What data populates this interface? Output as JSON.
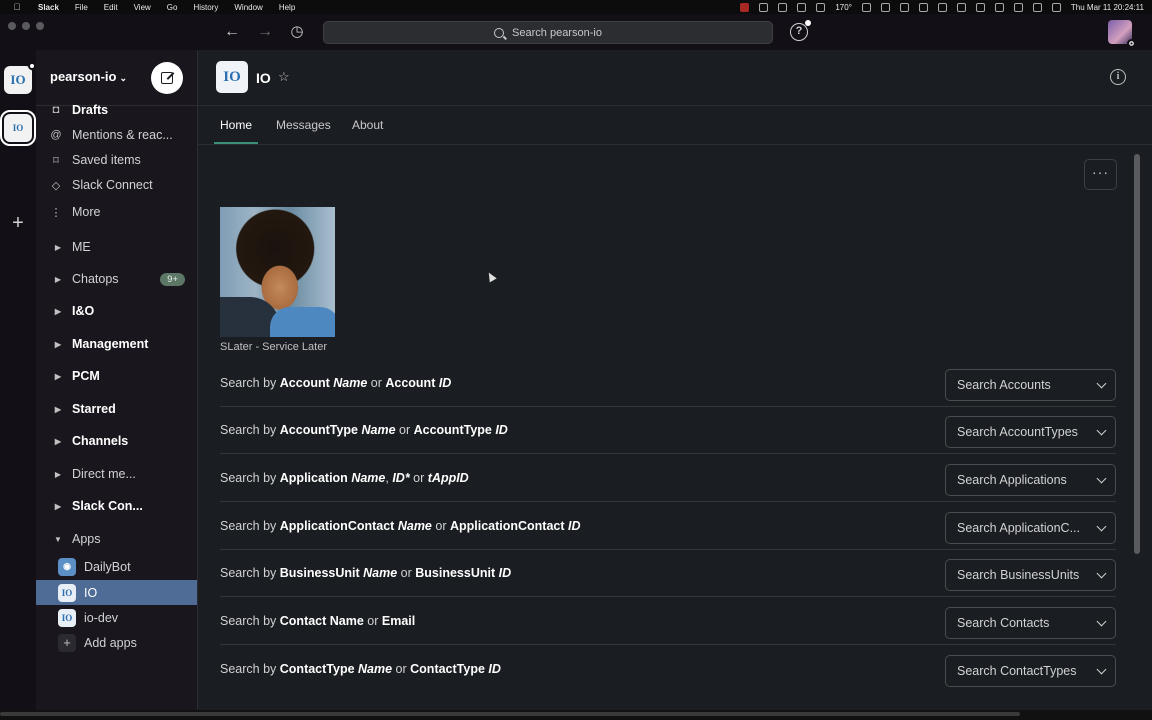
{
  "menubar": {
    "app": "Slack",
    "items": [
      "File",
      "Edit",
      "View",
      "Go",
      "History",
      "Window",
      "Help"
    ],
    "temp": "170°",
    "datetime": "Thu Mar 11  20:24:11"
  },
  "titlebar": {
    "search_placeholder": "Search pearson-io",
    "help_label": "?"
  },
  "workspace": {
    "name": "pearson-io",
    "icon_text": "IO"
  },
  "sidebar": {
    "nav": [
      {
        "label": "Drafts",
        "icon": "drafts-icon",
        "glyph": "◘"
      },
      {
        "label": "Mentions & reac...",
        "icon": "mention-icon",
        "glyph": "@"
      },
      {
        "label": "Saved items",
        "icon": "bookmark-icon",
        "glyph": "⌑"
      },
      {
        "label": "Slack Connect",
        "icon": "connect-icon",
        "glyph": "◇"
      },
      {
        "label": "More",
        "icon": "more-vertical-icon",
        "glyph": "⋮"
      }
    ],
    "sections": [
      {
        "label": "ME",
        "bold": false
      },
      {
        "label": "Chatops",
        "bold": false,
        "count": "9+"
      },
      {
        "label": "I&O",
        "bold": true
      },
      {
        "label": "Management",
        "bold": true
      },
      {
        "label": "PCM",
        "bold": true
      },
      {
        "label": "Starred",
        "bold": true
      },
      {
        "label": "Channels",
        "bold": true
      },
      {
        "label": "Direct me...",
        "bold": false
      },
      {
        "label": "Slack Con...",
        "bold": true
      },
      {
        "label": "Apps",
        "bold": false
      }
    ],
    "apps": [
      {
        "label": "DailyBot"
      },
      {
        "label": "IO"
      },
      {
        "label": "io-dev"
      },
      {
        "label": "Add apps"
      }
    ]
  },
  "channel": {
    "name": "IO",
    "icon_text": "IO",
    "tabs": [
      "Home",
      "Messages",
      "About"
    ],
    "more_label": "···",
    "image_caption": "SLater - Service Later"
  },
  "search_rows": [
    {
      "prefix": "Search by ",
      "parts": [
        [
          "b",
          "Account"
        ],
        [
          "t",
          " "
        ],
        [
          "i",
          "Name"
        ],
        [
          "t",
          " or "
        ],
        [
          "b",
          "Account"
        ],
        [
          "t",
          ""
        ],
        [
          "i",
          " ID"
        ]
      ],
      "button": "Search Accounts"
    },
    {
      "prefix": "Search by ",
      "parts": [
        [
          "b",
          "AccountType"
        ],
        [
          "t",
          " "
        ],
        [
          "i",
          "Name"
        ],
        [
          "t",
          " or "
        ],
        [
          "b",
          "AccountType"
        ],
        [
          "i",
          " ID"
        ]
      ],
      "button": "Search AccountTypes"
    },
    {
      "prefix": "Search by ",
      "parts": [
        [
          "b",
          "Application"
        ],
        [
          "t",
          " "
        ],
        [
          "i",
          "Name"
        ],
        [
          "t",
          ", "
        ],
        [
          "i",
          "ID*"
        ],
        [
          "t",
          " or "
        ],
        [
          "i",
          "tAppID"
        ]
      ],
      "button": "Search Applications"
    },
    {
      "prefix": "Search by ",
      "parts": [
        [
          "b",
          "ApplicationContact"
        ],
        [
          "t",
          " "
        ],
        [
          "i",
          "Name"
        ],
        [
          "t",
          " or "
        ],
        [
          "b",
          "ApplicationContact"
        ],
        [
          "i",
          " ID"
        ]
      ],
      "button": "Search ApplicationC..."
    },
    {
      "prefix": "Search by ",
      "parts": [
        [
          "b",
          "BusinessUnit"
        ],
        [
          "t",
          " "
        ],
        [
          "i",
          "Name"
        ],
        [
          "t",
          " or "
        ],
        [
          "b",
          "BusinessUnit"
        ],
        [
          "i",
          " ID"
        ]
      ],
      "button": "Search BusinessUnits"
    },
    {
      "prefix": "Search by ",
      "parts": [
        [
          "b",
          "Contact Name"
        ],
        [
          "t",
          " or "
        ],
        [
          "b",
          "Email"
        ]
      ],
      "button": "Search Contacts"
    },
    {
      "prefix": "Search by ",
      "parts": [
        [
          "b",
          "ContactType"
        ],
        [
          "t",
          " "
        ],
        [
          "i",
          "Name"
        ],
        [
          "t",
          " or "
        ],
        [
          "b",
          "ContactType"
        ],
        [
          "i",
          " ID"
        ]
      ],
      "button": "Search ContactTypes"
    }
  ],
  "colors": {
    "selected_app_bg": "#4e6c96",
    "tab_underline": "#3c8f78",
    "badge_bg": "#5c7765"
  }
}
